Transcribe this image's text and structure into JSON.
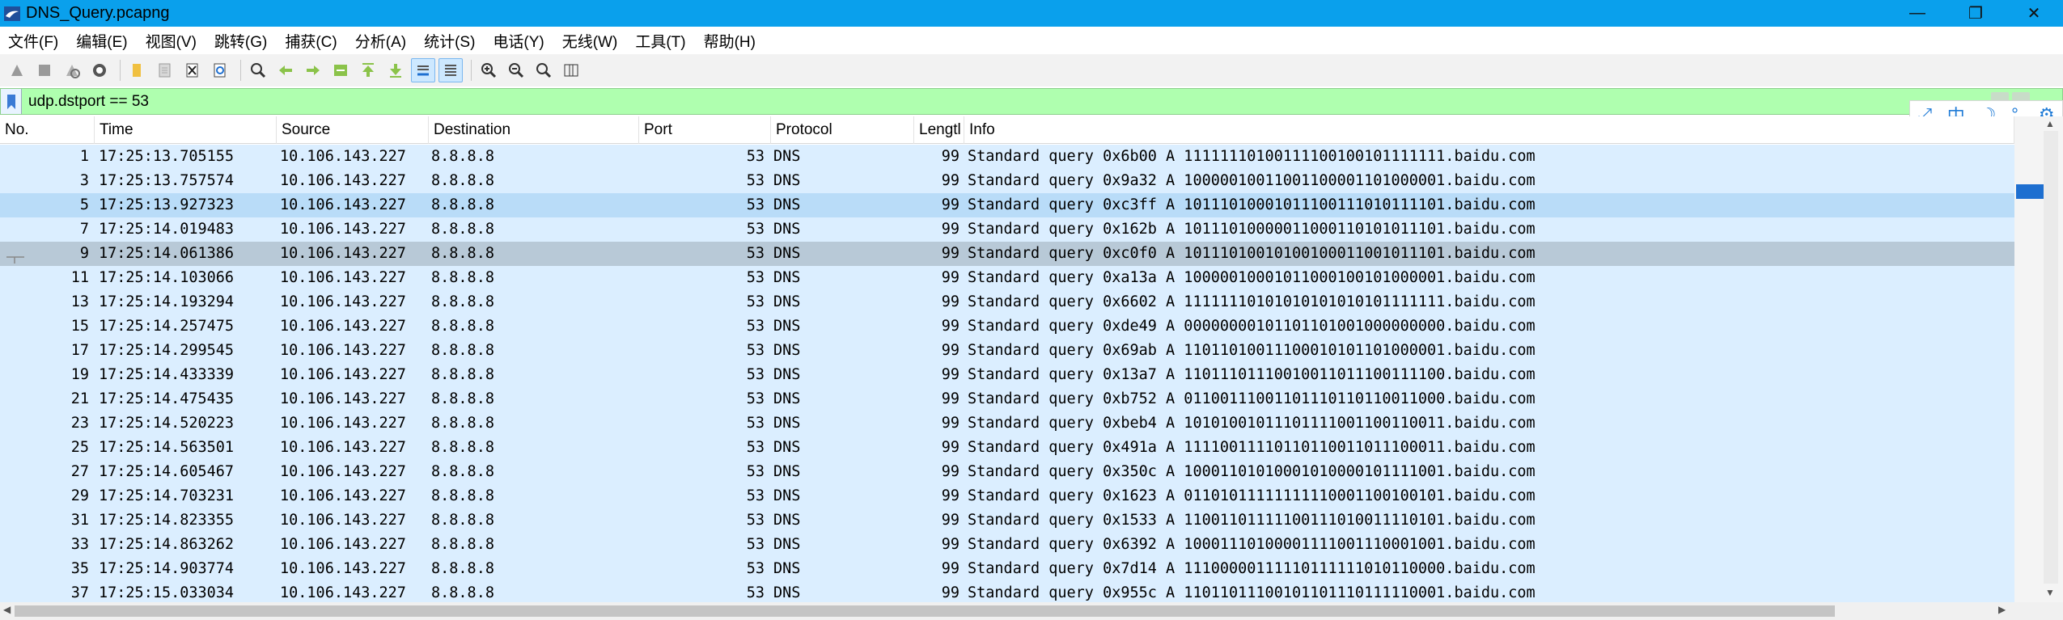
{
  "window": {
    "title": "DNS_Query.pcapng",
    "minimize": "—",
    "maximize": "❐",
    "close": "✕"
  },
  "menu": [
    {
      "label": "文件(F)"
    },
    {
      "label": "编辑(E)"
    },
    {
      "label": "视图(V)"
    },
    {
      "label": "跳转(G)"
    },
    {
      "label": "捕获(C)"
    },
    {
      "label": "分析(A)"
    },
    {
      "label": "统计(S)"
    },
    {
      "label": "电话(Y)"
    },
    {
      "label": "无线(W)"
    },
    {
      "label": "工具(T)"
    },
    {
      "label": "帮助(H)"
    }
  ],
  "toolbar_icons": [
    "start-capture-icon",
    "stop-capture-icon",
    "restart-capture-icon",
    "capture-options-icon",
    "open-file-icon",
    "save-file-icon",
    "close-file-icon",
    "reload-file-icon",
    "find-packet-icon",
    "go-back-icon",
    "go-forward-icon",
    "go-to-packet-icon",
    "go-first-icon",
    "go-last-icon",
    "auto-scroll-icon",
    "colorize-icon",
    "zoom-in-icon",
    "zoom-out-icon",
    "normal-size-icon",
    "resize-columns-icon"
  ],
  "filter": {
    "value": "udp.dstport == 53"
  },
  "ime": {
    "mode": "中",
    "moon": "☽",
    "punct": "°,",
    "settings": "⚙"
  },
  "columns": {
    "no": "No.",
    "time": "Time",
    "source": "Source",
    "destination": "Destination",
    "port": "Port",
    "protocol": "Protocol",
    "length": "Lengtl",
    "info": "Info"
  },
  "packets": [
    {
      "no": "1",
      "time": "17:25:13.705155",
      "src": "10.106.143.227",
      "dst": "8.8.8.8",
      "port": "53",
      "proto": "DNS",
      "len": "99",
      "info": "Standard query 0x6b00 A 11111110100111100100101111111.baidu.com",
      "state": "normal"
    },
    {
      "no": "3",
      "time": "17:25:13.757574",
      "src": "10.106.143.227",
      "dst": "8.8.8.8",
      "port": "53",
      "proto": "DNS",
      "len": "99",
      "info": "Standard query 0x9a32 A 10000010011001100001101000001.baidu.com",
      "state": "normal"
    },
    {
      "no": "5",
      "time": "17:25:13.927323",
      "src": "10.106.143.227",
      "dst": "8.8.8.8",
      "port": "53",
      "proto": "DNS",
      "len": "99",
      "info": "Standard query 0xc3ff A 10111010001011100111010111101.baidu.com",
      "state": "selected"
    },
    {
      "no": "7",
      "time": "17:25:14.019483",
      "src": "10.106.143.227",
      "dst": "8.8.8.8",
      "port": "53",
      "proto": "DNS",
      "len": "99",
      "info": "Standard query 0x162b A 10111010000011000110101011101.baidu.com",
      "state": "normal"
    },
    {
      "no": "9",
      "time": "17:25:14.061386",
      "src": "10.106.143.227",
      "dst": "8.8.8.8",
      "port": "53",
      "proto": "DNS",
      "len": "99",
      "info": "Standard query 0xc0f0 A 10111010010100100011001011101.baidu.com",
      "state": "marked"
    },
    {
      "no": "11",
      "time": "17:25:14.103066",
      "src": "10.106.143.227",
      "dst": "8.8.8.8",
      "port": "53",
      "proto": "DNS",
      "len": "99",
      "info": "Standard query 0xa13a A 10000010001011000100101000001.baidu.com",
      "state": "normal"
    },
    {
      "no": "13",
      "time": "17:25:14.193294",
      "src": "10.106.143.227",
      "dst": "8.8.8.8",
      "port": "53",
      "proto": "DNS",
      "len": "99",
      "info": "Standard query 0x6602 A 11111110101010101010101111111.baidu.com",
      "state": "normal"
    },
    {
      "no": "15",
      "time": "17:25:14.257475",
      "src": "10.106.143.227",
      "dst": "8.8.8.8",
      "port": "53",
      "proto": "DNS",
      "len": "99",
      "info": "Standard query 0xde49 A 00000000101101101001000000000.baidu.com",
      "state": "normal"
    },
    {
      "no": "17",
      "time": "17:25:14.299545",
      "src": "10.106.143.227",
      "dst": "8.8.8.8",
      "port": "53",
      "proto": "DNS",
      "len": "99",
      "info": "Standard query 0x69ab A 11011010011100010101101000001.baidu.com",
      "state": "normal"
    },
    {
      "no": "19",
      "time": "17:25:14.433339",
      "src": "10.106.143.227",
      "dst": "8.8.8.8",
      "port": "53",
      "proto": "DNS",
      "len": "99",
      "info": "Standard query 0x13a7 A 11011101110010011011100111100.baidu.com",
      "state": "normal"
    },
    {
      "no": "21",
      "time": "17:25:14.475435",
      "src": "10.106.143.227",
      "dst": "8.8.8.8",
      "port": "53",
      "proto": "DNS",
      "len": "99",
      "info": "Standard query 0xb752 A 01100111001101110110110011000.baidu.com",
      "state": "normal"
    },
    {
      "no": "23",
      "time": "17:25:14.520223",
      "src": "10.106.143.227",
      "dst": "8.8.8.8",
      "port": "53",
      "proto": "DNS",
      "len": "99",
      "info": "Standard query 0xbeb4 A 10101001011101111001100110011.baidu.com",
      "state": "normal"
    },
    {
      "no": "25",
      "time": "17:25:14.563501",
      "src": "10.106.143.227",
      "dst": "8.8.8.8",
      "port": "53",
      "proto": "DNS",
      "len": "99",
      "info": "Standard query 0x491a A 11110011110110110011011100011.baidu.com",
      "state": "normal"
    },
    {
      "no": "27",
      "time": "17:25:14.605467",
      "src": "10.106.143.227",
      "dst": "8.8.8.8",
      "port": "53",
      "proto": "DNS",
      "len": "99",
      "info": "Standard query 0x350c A 10001101010001010000101111001.baidu.com",
      "state": "normal"
    },
    {
      "no": "29",
      "time": "17:25:14.703231",
      "src": "10.106.143.227",
      "dst": "8.8.8.8",
      "port": "53",
      "proto": "DNS",
      "len": "99",
      "info": "Standard query 0x1623 A 01101011111111110001100100101.baidu.com",
      "state": "normal"
    },
    {
      "no": "31",
      "time": "17:25:14.823355",
      "src": "10.106.143.227",
      "dst": "8.8.8.8",
      "port": "53",
      "proto": "DNS",
      "len": "99",
      "info": "Standard query 0x1533 A 11001101111100111010011110101.baidu.com",
      "state": "normal"
    },
    {
      "no": "33",
      "time": "17:25:14.863262",
      "src": "10.106.143.227",
      "dst": "8.8.8.8",
      "port": "53",
      "proto": "DNS",
      "len": "99",
      "info": "Standard query 0x6392 A 10001110100001111001110001001.baidu.com",
      "state": "normal"
    },
    {
      "no": "35",
      "time": "17:25:14.903774",
      "src": "10.106.143.227",
      "dst": "8.8.8.8",
      "port": "53",
      "proto": "DNS",
      "len": "99",
      "info": "Standard query 0x7d14 A 11100000111110111111010110000.baidu.com",
      "state": "normal"
    },
    {
      "no": "37",
      "time": "17:25:15.033034",
      "src": "10.106.143.227",
      "dst": "8.8.8.8",
      "port": "53",
      "proto": "DNS",
      "len": "99",
      "info": "Standard query 0x955c A 11011011100101101110111110001.baidu.com",
      "state": "normal"
    }
  ],
  "colors": {
    "titlebar": "#0aa0ec",
    "filter_bg": "#afffaf",
    "row_bg": "#dbeeff",
    "row_selected": "#b9dcf8",
    "row_marked": "#b8c9d7"
  }
}
